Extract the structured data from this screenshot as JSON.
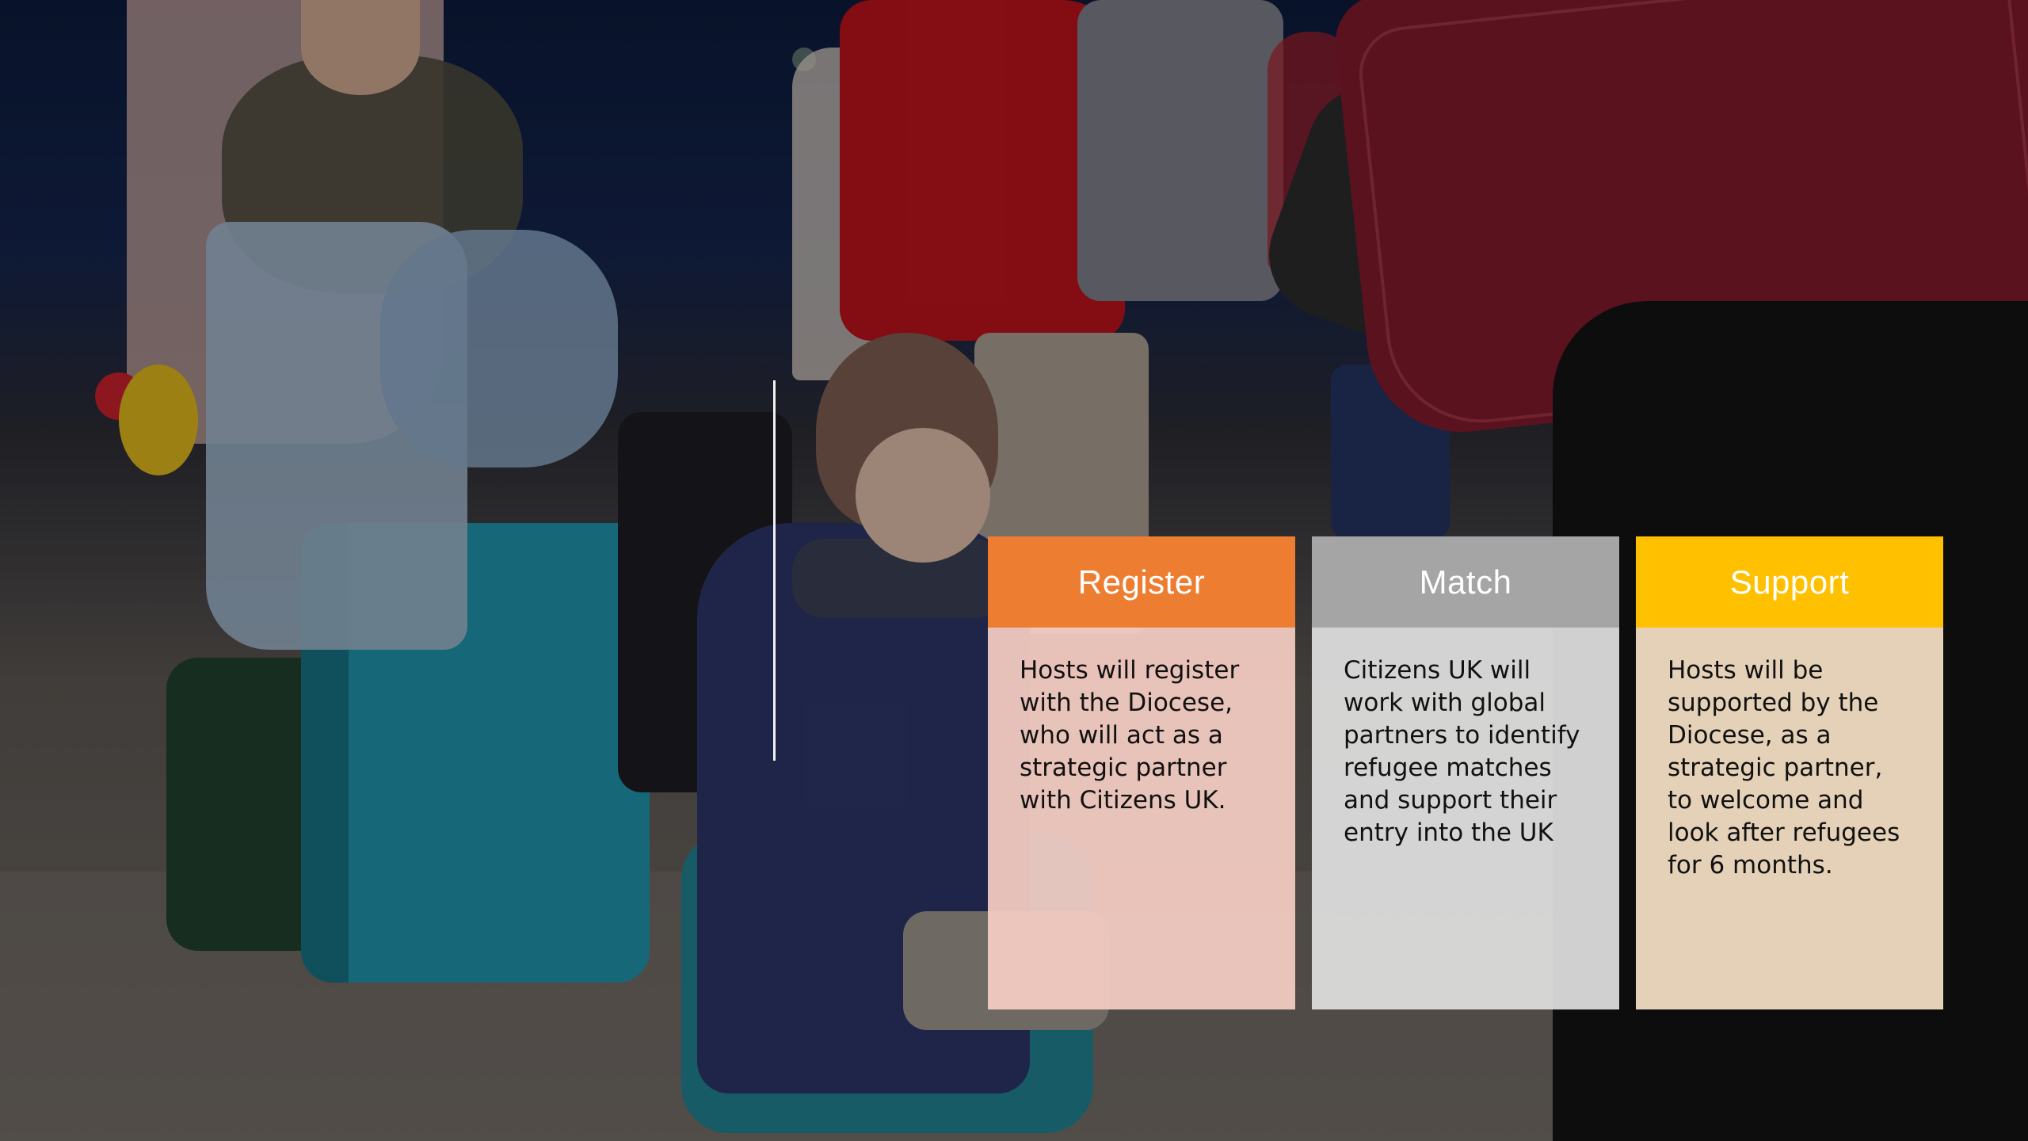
{
  "slide": {
    "background_photo": "refugee-families-with-luggage-photo",
    "cards": [
      {
        "title": "Register",
        "body": "Hosts will register with the Diocese, who will act as a strategic partner with Citizens UK.",
        "header_color": "#ed7d31"
      },
      {
        "title": "Match",
        "body": "Citizens UK will work with global partners to identify refugee matches and support their entry into the UK",
        "header_color": "#a5a5a5"
      },
      {
        "title": "Support",
        "body": "Hosts will be supported by the Diocese, as a strategic partner, to welcome and look after refugees for 6 months.",
        "header_color": "#ffc000"
      }
    ]
  }
}
